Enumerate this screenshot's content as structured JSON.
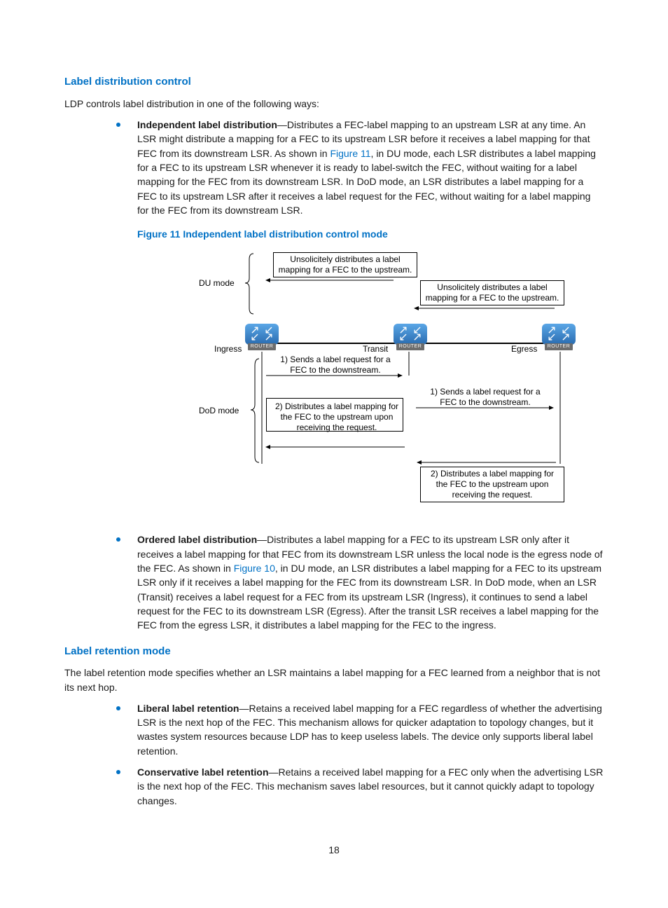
{
  "page_number": "18",
  "s1": {
    "title": "Label distribution control",
    "intro": "LDP controls label distribution in one of the following ways:",
    "b1_bold": "Independent label distribution",
    "b1_pre": "—Distributes a FEC-label mapping to an upstream LSR at any time. An LSR might distribute a mapping for a FEC to its upstream LSR before it receives a label mapping for that FEC from its downstream LSR. As shown in ",
    "b1_link": "Figure 11",
    "b1_post": ", in DU mode, each LSR distributes a label mapping for a FEC to its upstream LSR whenever it is ready to label-switch the FEC, without waiting for a label mapping for the FEC from its downstream LSR. In DoD mode, an LSR distributes a label mapping for a FEC to its upstream LSR after it receives a label request for the FEC, without waiting for a label mapping for the FEC from its downstream LSR.",
    "fig_caption": "Figure 11 Independent label distribution control mode",
    "b2_bold": "Ordered label distribution",
    "b2_pre": "—Distributes a label mapping for a FEC to its upstream LSR only after it receives a label mapping for that FEC from its downstream LSR unless the local node is the egress node of the FEC. As shown in ",
    "b2_link": "Figure 10",
    "b2_post": ", in DU mode, an LSR distributes a label mapping for a FEC to its upstream LSR only if it receives a label mapping for the FEC from its downstream LSR. In DoD mode, when an LSR (Transit) receives a label request for a FEC from its upstream LSR (Ingress), it continues to send a label request for the FEC to its downstream LSR (Egress). After the transit LSR receives a label mapping for the FEC from the egress LSR, it distributes a label mapping for the FEC to the ingress."
  },
  "s2": {
    "title": "Label retention mode",
    "intro": "The label retention mode specifies whether an LSR maintains a label mapping for a FEC learned from a neighbor that is not its next hop.",
    "b1_bold": "Liberal label retention",
    "b1_text": "—Retains a received label mapping for a FEC regardless of whether the advertising LSR is the next hop of the FEC. This mechanism allows for quicker adaptation to topology changes, but it wastes system resources because LDP has to keep useless labels. The device only supports liberal label retention.",
    "b2_bold": "Conservative label retention",
    "b2_text": "—Retains a received label mapping for a FEC only when the advertising LSR is the next hop of the FEC. This mechanism saves label resources, but it cannot quickly adapt to topology changes."
  },
  "diagram": {
    "du_mode": "DU mode",
    "dod_mode": "DoD mode",
    "ingress": "Ingress",
    "transit": "Transit",
    "egress": "Egress",
    "router_cap": "ROUTER",
    "du_box1_l1": "Unsolicitely distributes a label",
    "du_box1_l2": "mapping for a FEC to the upstream.",
    "du_box2_l1": "Unsolicitely distributes a label",
    "du_box2_l2": "mapping for a FEC to the upstream.",
    "dod_req1_l1": "1) Sends a label request for a",
    "dod_req1_l2": "FEC to the downstream.",
    "dod_req2_l1": "1) Sends a label request for a",
    "dod_req2_l2": "FEC to the downstream.",
    "dod_dist1_l1": "2) Distributes a label mapping for",
    "dod_dist1_l2": "the FEC to the upstream upon",
    "dod_dist1_l3": "receiving the request.",
    "dod_dist2_l1": "2) Distributes a label mapping for",
    "dod_dist2_l2": "the FEC to the upstream upon",
    "dod_dist2_l3": "receiving the request."
  }
}
